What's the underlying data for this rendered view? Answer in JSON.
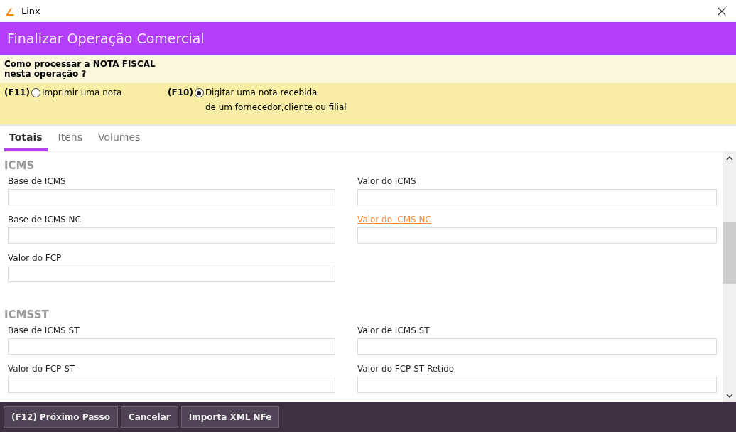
{
  "window": {
    "title": "Linx"
  },
  "header": {
    "title": "Finalizar Operação Comercial"
  },
  "question": {
    "text": "Como processar a NOTA FISCAL\nnesta operação ?",
    "options": [
      {
        "key": "(F11)",
        "label": "Imprimir uma nota",
        "selected": false
      },
      {
        "key": "(F10)",
        "label": "Digitar uma nota recebida\nde um fornecedor,cliente ou filial",
        "selected": true
      }
    ]
  },
  "tabs": [
    {
      "label": "Totais",
      "selected": true
    },
    {
      "label": "Itens",
      "selected": false
    },
    {
      "label": "Volumes",
      "selected": false
    }
  ],
  "sections": [
    {
      "title": "ICMS",
      "fields": [
        {
          "label": "Base de ICMS",
          "kind": "plain"
        },
        {
          "label": "Valor do ICMS",
          "kind": "plain"
        },
        {
          "label": "Base de ICMS NC",
          "kind": "plain"
        },
        {
          "label": "Valor do ICMS NC",
          "kind": "link"
        },
        {
          "label": "Valor do FCP",
          "kind": "plain"
        }
      ]
    },
    {
      "title": "ICMSST",
      "fields": [
        {
          "label": "Base de ICMS ST",
          "kind": "plain"
        },
        {
          "label": "Valor de ICMS ST",
          "kind": "plain"
        },
        {
          "label": "Valor do FCP ST",
          "kind": "plain"
        },
        {
          "label": "Valor do FCP ST Retido",
          "kind": "plain"
        }
      ]
    }
  ],
  "buttons": [
    "(F12) Próximo Passo",
    "Cancelar",
    "Importa XML NFe"
  ]
}
